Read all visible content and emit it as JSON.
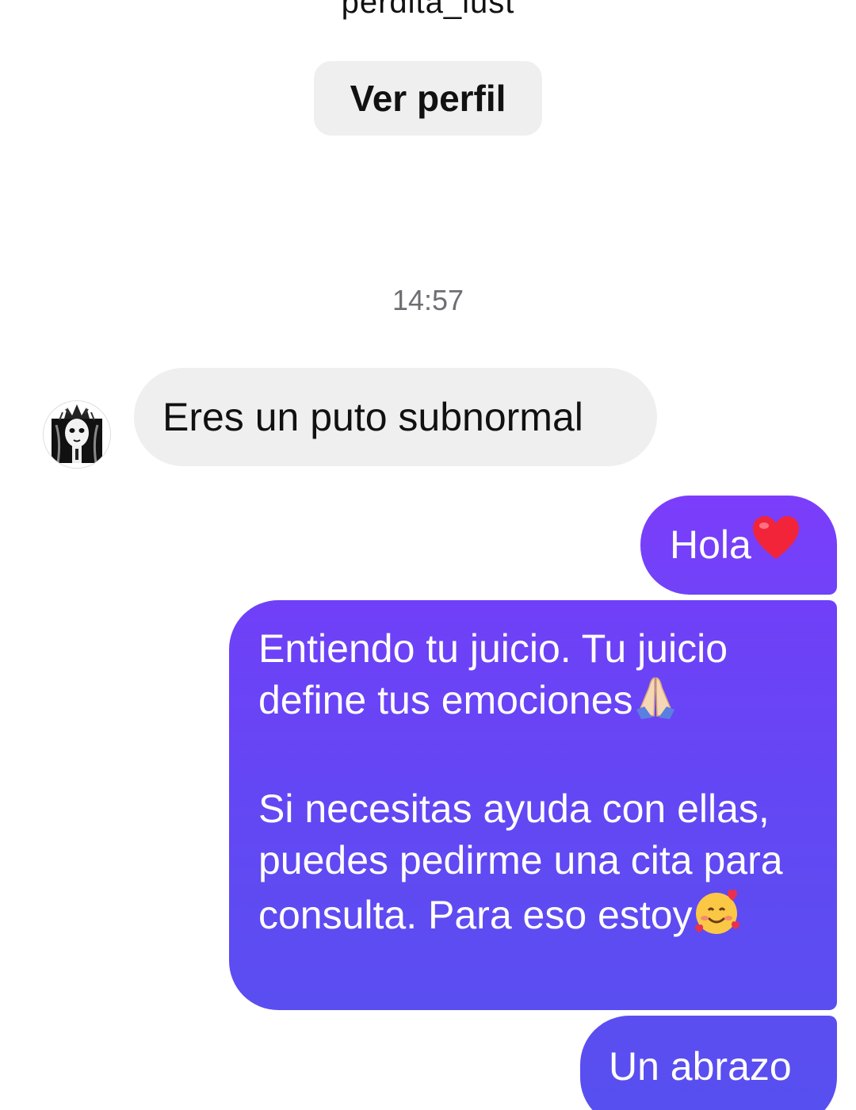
{
  "header": {
    "username": "perdita_lust",
    "view_profile_label": "Ver perfil"
  },
  "thread": {
    "timestamp": "14:57",
    "incoming": [
      {
        "text": "Eres un puto subnormal"
      }
    ],
    "outgoing": [
      {
        "text": "Hola",
        "emoji": "red-heart-icon"
      },
      {
        "text_line1": "Entiendo tu juicio. Tu juicio",
        "text_line2": "define tus emociones",
        "emoji_1": "folded-hands-icon",
        "text_para2": "Si necesitas ayuda con ellas, puedes pedirme una cita para consulta. Para eso estoy",
        "emoji_2": "smiling-face-with-hearts-icon"
      },
      {
        "text": "Un abrazo"
      }
    ]
  },
  "colors": {
    "outgoing_bubble_top": "#7c3dfb",
    "outgoing_bubble_bottom": "#574ff0",
    "incoming_bubble": "#efeff0",
    "timestamp_text": "#6e6e73"
  }
}
